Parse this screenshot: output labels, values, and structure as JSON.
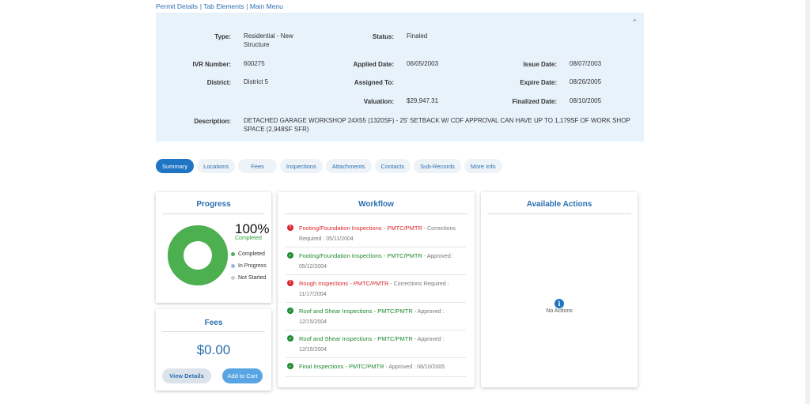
{
  "topnav": {
    "permit_details": "Permit Details",
    "tab_elements": "Tab Elements",
    "main_menu": "Main Menu",
    "separator": "|"
  },
  "permit": {
    "labels": {
      "type": "Type:",
      "status": "Status:",
      "ivr": "IVR Number:",
      "applied": "Applied Date:",
      "issue": "Issue Date:",
      "district": "District:",
      "assigned": "Assigned To:",
      "expire": "Expire Date:",
      "valuation": "Valuation:",
      "finalized": "Finalized Date:",
      "description": "Description:"
    },
    "type_line1": "Residential - New",
    "type_line2": "Structure",
    "status": "Finaled",
    "ivr_number": "600275",
    "applied_date": "06/05/2003",
    "issue_date": "08/07/2003",
    "district": "District 5",
    "assigned_to": "",
    "expire_date": "08/26/2005",
    "valuation": "$29,947.31",
    "finalized_date": "08/10/2005",
    "description_line1": "DETACHED GARAGE WORKSHOP 24X55 (1320SF) - 25' SETBACK W/ CDF APPROVAL CAN HAVE UP TO 1,179SF OF WORK SHOP",
    "description_line2": "SPACE (2,948SF SFR)"
  },
  "tabs": [
    "Summary",
    "Locations",
    "Fees",
    "Inspections",
    "Attachments",
    "Contacts",
    "Sub-Records",
    "More Info"
  ],
  "progress": {
    "title": "Progress",
    "percent_text": "100%",
    "percent_label": "Completed",
    "completed_fraction": 1.0,
    "legend": [
      "Completed",
      "In Progress",
      "Not Started"
    ],
    "colors": {
      "completed": "#4caf50",
      "in_progress": "#9db8d6",
      "not_started": "#cccccc"
    }
  },
  "fees": {
    "title": "Fees",
    "amount": "$0.00",
    "view_details": "View Details",
    "add_to_cart": "Add to Cart"
  },
  "workflow": {
    "title": "Workflow",
    "items": [
      {
        "name": "Footing/Foundation Inspections - PMTC/PMTR",
        "status_a": " - Corrections",
        "status_b": "Required : 05/11/2004",
        "state": "red"
      },
      {
        "name": "Footing/Foundation Inspections - PMTC/PMTR",
        "status_a": " - Approved :",
        "status_b": "05/12/2004",
        "state": "green"
      },
      {
        "name": "Rough Inspections - PMTC/PMTR",
        "status_a": " - Corrections Required :",
        "status_b": "11/17/2004",
        "state": "red"
      },
      {
        "name": "Roof and Shear Inspections - PMTC/PMTR",
        "status_a": " - Approved :",
        "status_b": "12/15/2004",
        "state": "green"
      },
      {
        "name": "Roof and Shear Inspections - PMTC/PMTR",
        "status_a": " - Approved :",
        "status_b": "12/15/2004",
        "state": "green"
      },
      {
        "name": "Final Inspections - PMTC/PMTR",
        "status_a": " - Approved : 08/10/2005",
        "status_b": "",
        "state": "green"
      }
    ]
  },
  "actions": {
    "title": "Available Actions",
    "empty_text": "No Actions"
  },
  "icons": {
    "collapse": "chevron-up-icon",
    "error": "exclamation-circle-icon",
    "success": "check-circle-icon",
    "info": "info-circle-icon"
  }
}
